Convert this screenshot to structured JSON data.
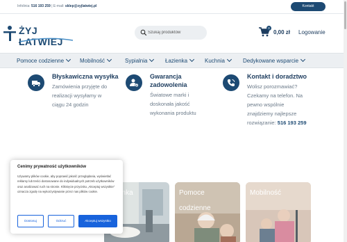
{
  "topbar": {
    "info_label": "Infolinia:",
    "phone": "516 193 259",
    "email_label": "| E-mail:",
    "email": "sklep@zyjlatwiej.pl",
    "contact_button": "Kontakt"
  },
  "header": {
    "logo_text": "ŻYJ ŁATWIEJ",
    "search_placeholder": "Szukaj produktów",
    "cart_count": "0",
    "cart_total": "0,00 zł",
    "login": "Logowanie"
  },
  "nav": {
    "items": [
      {
        "label": "Pomoce codzienne"
      },
      {
        "label": "Mobilność"
      },
      {
        "label": "Sypialnia"
      },
      {
        "label": "Łazienka"
      },
      {
        "label": "Kuchnia"
      },
      {
        "label": "Dedykowane wsparcie"
      }
    ]
  },
  "features": [
    {
      "icon": "truck-icon",
      "title": "Błyskawiczna wysyłka",
      "lines": [
        "Zamówienia przyjęte do",
        "realizacji wysyłamy w",
        "ciągu 24 godzin"
      ]
    },
    {
      "icon": "user-check-icon",
      "title_lines": [
        "Gwarancja",
        "zadowolenia"
      ],
      "lines": [
        "Światowe marki i",
        "doskonała jakość",
        "wykonania produktu"
      ]
    },
    {
      "icon": "phone-icon",
      "title": "Kontakt i doradztwo",
      "lines": [
        "Wolisz porozmawiać?",
        "Czekamy na telefon. Na",
        "pewno wspólnie",
        "znajdziemy najlepsze"
      ],
      "last_line_prefix": "rozwiązanie:",
      "last_line_phone": "516 193 259"
    }
  ],
  "tiles": [
    {
      "label": "Łazienka",
      "visible_label": "enka"
    },
    {
      "label_lines": [
        "Pomoce",
        "codzienne"
      ]
    },
    {
      "label": "Mobilność"
    }
  ],
  "cookie": {
    "title": "Cenimy prywatność użytkowników",
    "text": "Używamy plików cookie, aby poprawić jakość przeglądania, wyświetlać reklamy lub treści dostosowane do indywidualnych potrzeb użytkowników oraz analizować ruch na stronie. Kliknięcie przycisku „Akceptuj wszystkie” oznacza zgodę na wykorzystywanie przez nas plików cookie.",
    "customize": "Dostosuj",
    "reject": "Odrzuć",
    "accept": "Akceptuj wszystko"
  },
  "colors": {
    "brand": "#1d4a73",
    "cookie_accent": "#1863dc",
    "nav_bg": "#eceff2"
  }
}
